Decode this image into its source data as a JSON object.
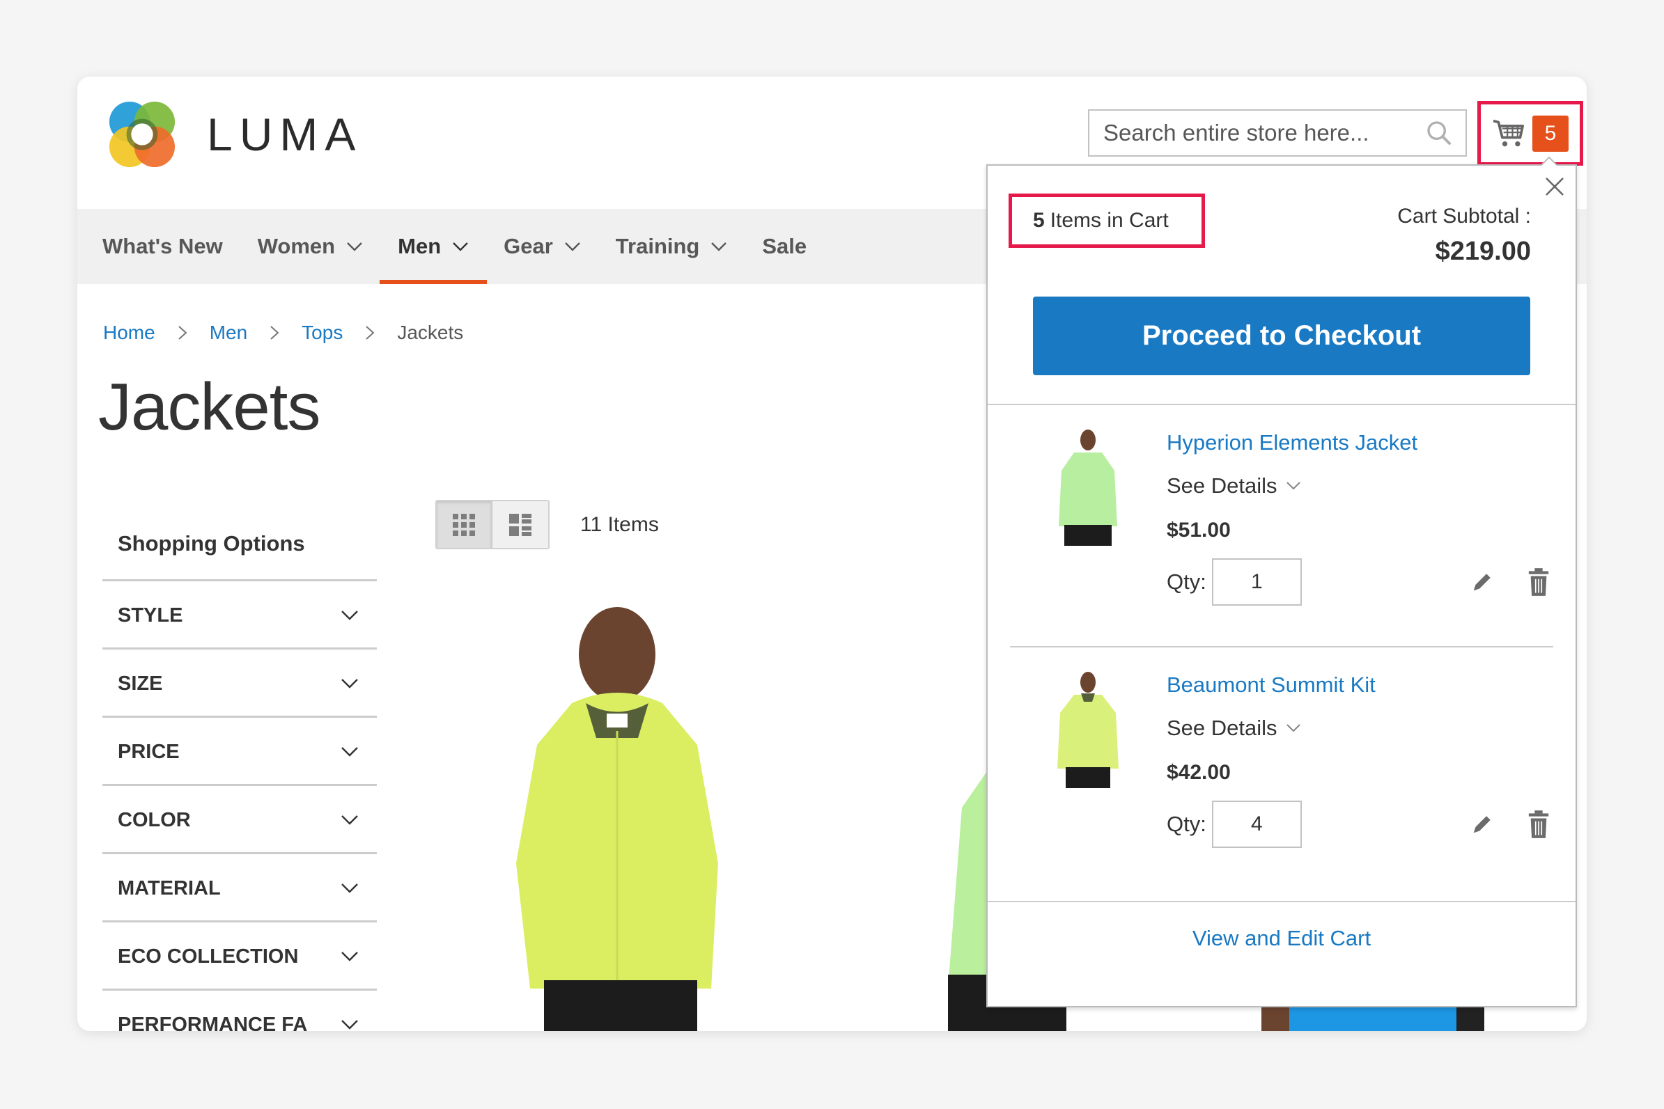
{
  "header": {
    "logo_text": "LUMA",
    "search_placeholder": "Search entire store here...",
    "cart_count": "5"
  },
  "nav": {
    "items": [
      {
        "label": "What's New",
        "has_dropdown": false,
        "active": false
      },
      {
        "label": "Women",
        "has_dropdown": true,
        "active": false
      },
      {
        "label": "Men",
        "has_dropdown": true,
        "active": true
      },
      {
        "label": "Gear",
        "has_dropdown": true,
        "active": false
      },
      {
        "label": "Training",
        "has_dropdown": true,
        "active": false
      },
      {
        "label": "Sale",
        "has_dropdown": false,
        "active": false
      }
    ]
  },
  "breadcrumbs": [
    {
      "label": "Home",
      "link": true
    },
    {
      "label": "Men",
      "link": true
    },
    {
      "label": "Tops",
      "link": true
    },
    {
      "label": "Jackets",
      "link": false
    }
  ],
  "page_title": "Jackets",
  "sidebar": {
    "title": "Shopping Options",
    "filters": [
      "STYLE",
      "SIZE",
      "PRICE",
      "COLOR",
      "MATERIAL",
      "ECO COLLECTION",
      "PERFORMANCE FA BRIC"
    ]
  },
  "toolbar": {
    "view_modes": [
      "grid",
      "list"
    ],
    "active_view": "grid",
    "amount": "11 Items"
  },
  "minicart": {
    "count_number": "5",
    "count_label": "Items in Cart",
    "subtotal_label": "Cart Subtotal :",
    "subtotal_value": "$219.00",
    "checkout_label": "Proceed to Checkout",
    "items": [
      {
        "name": "Hyperion Elements Jacket",
        "see_details": "See Details",
        "price": "$51.00",
        "qty_label": "Qty:",
        "qty": "1",
        "color": "#b8eea0"
      },
      {
        "name": "Beaumont Summit Kit",
        "see_details": "See Details",
        "price": "$42.00",
        "qty_label": "Qty:",
        "qty": "4",
        "color": "#d9f07a"
      }
    ],
    "view_cart_label": "View and Edit Cart"
  },
  "colors": {
    "accent_orange": "#e5501b",
    "link_blue": "#1979c3",
    "highlight_red": "#e5194a"
  }
}
